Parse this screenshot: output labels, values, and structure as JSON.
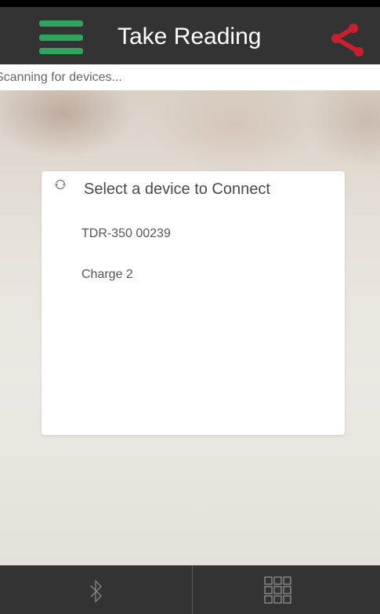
{
  "header": {
    "title": "Take Reading",
    "menu_icon": "hamburger-menu-icon",
    "share_icon": "share-icon"
  },
  "status": {
    "text": "Scanning for devices..."
  },
  "dialog": {
    "title": "Select a device to Connect",
    "icon": "refresh-icon",
    "devices": [
      {
        "label": "TDR-350 00239"
      },
      {
        "label": "Charge 2"
      }
    ]
  },
  "bottom_nav": {
    "items": [
      {
        "icon": "bluetooth-icon"
      },
      {
        "icon": "grid-icon"
      }
    ]
  },
  "colors": {
    "appbar": "#333333",
    "accent_green": "#2fa45f",
    "share_red": "#c8202e"
  }
}
